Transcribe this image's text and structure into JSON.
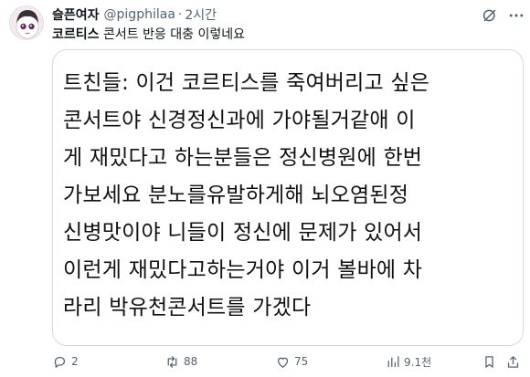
{
  "tweet": {
    "author_name": "슬픈여자",
    "handle": "@pigphilaa",
    "separator": "·",
    "time": "2시간",
    "text_strong": "코르티스",
    "text_rest": " 콘서트 반응 대충 이렇네요",
    "card_lines": [
      "트친들: 이건 코르티스를 죽여버리고 싶은",
      "콘서트야 신경정신과에 가야될거같애 이",
      "게 재밌다고 하는분들은 정신병원에 한번",
      "가보세요 분노를유발하게해 뇌오염된정",
      "신병맛이야 니들이 정신에 문제가 있어서",
      "이런게 재밌다고하는거야 이거 볼바에 차",
      "라리 박유천콘서트를 가겠다"
    ],
    "actions": {
      "replies": "2",
      "reposts": "88",
      "likes": "75",
      "views": "9.1천"
    },
    "colors": {
      "secondary_text": "#536471",
      "border": "#cfd9de"
    }
  }
}
